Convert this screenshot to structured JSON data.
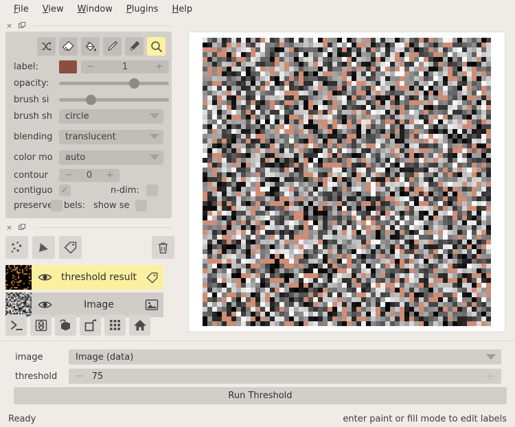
{
  "menubar": {
    "items": [
      {
        "prefix": "",
        "mnemonic": "F",
        "rest": "ile"
      },
      {
        "prefix": "",
        "mnemonic": "V",
        "rest": "iew"
      },
      {
        "prefix": "",
        "mnemonic": "W",
        "rest": "indow"
      },
      {
        "prefix": "",
        "mnemonic": "P",
        "rest": "lugins"
      },
      {
        "prefix": "",
        "mnemonic": "H",
        "rest": "elp"
      }
    ],
    "labels": [
      "File",
      "View",
      "Window",
      "Plugins",
      "Help"
    ]
  },
  "layer_controls": {
    "dock_close": "×",
    "dock_float": "❐",
    "tools": [
      {
        "name": "shuffle-colors-tool",
        "active": false
      },
      {
        "name": "eraser-tool",
        "active": false
      },
      {
        "name": "fill-tool",
        "active": false
      },
      {
        "name": "paint-brush-tool",
        "active": false
      },
      {
        "name": "color-picker-tool",
        "active": false
      },
      {
        "name": "pan-zoom-tool",
        "active": true
      }
    ],
    "label_row": {
      "label": "label:",
      "swatch_color": "#8a4f3f",
      "value": "1",
      "minus": "−",
      "plus": "+"
    },
    "opacity_row": {
      "label": "opacity:",
      "value_pct": 70
    },
    "brush_size_row": {
      "label": "brush si",
      "full_label": "brush size:",
      "value_pct": 27
    },
    "brush_shape_row": {
      "label": "brush sh",
      "full_label": "brush shape:",
      "value": "circle"
    },
    "blending_row": {
      "label": "blending",
      "full_label": "blending:",
      "value": "translucent"
    },
    "color_mode_row": {
      "label": "color mo",
      "full_label": "color mode:",
      "value": "auto"
    },
    "contour_row": {
      "label": "contour",
      "value": "0",
      "minus": "−",
      "plus": "+"
    },
    "contiguous_row": {
      "label": "contiguo",
      "full_label": "contiguous:",
      "checked": true,
      "check_glyph": "✓"
    },
    "ndim_row": {
      "label": "n-dim:",
      "checked": false
    },
    "preserve_row": {
      "label": "preserve",
      "full_label": "preserve labels:",
      "label_tail": "bels:",
      "checked": false
    },
    "show_selected_row": {
      "label": "show se",
      "full_label": "show selected:",
      "checked": false
    }
  },
  "layer_panel": {
    "dock_close": "×",
    "dock_float": "❐",
    "add_buttons": [
      {
        "name": "new-points-layer-button"
      },
      {
        "name": "new-shapes-layer-button"
      },
      {
        "name": "new-labels-layer-button"
      }
    ],
    "delete_button": {
      "name": "delete-layer-button"
    },
    "layers": [
      {
        "name": "threshold result",
        "type": "labels",
        "selected": true,
        "visible": true
      },
      {
        "name": "Image",
        "type": "image",
        "selected": false,
        "visible": true
      }
    ],
    "viewer_buttons": [
      {
        "name": "console-button"
      },
      {
        "name": "ndisplay-button"
      },
      {
        "name": "roll-dims-button"
      },
      {
        "name": "transpose-dims-button"
      },
      {
        "name": "grid-view-button"
      },
      {
        "name": "home-reset-view-button"
      }
    ]
  },
  "widget": {
    "image_row": {
      "label": "image",
      "value": "Image (data)"
    },
    "threshold_row": {
      "label": "threshold",
      "value": "75",
      "minus": "−",
      "plus": "+"
    },
    "run_button": "Run Threshold"
  },
  "statusbar": {
    "left": "Ready",
    "right": "enter paint or fill mode to edit labels"
  },
  "canvas": {
    "label_color": "#cf8d75",
    "background": "#ffffff"
  }
}
